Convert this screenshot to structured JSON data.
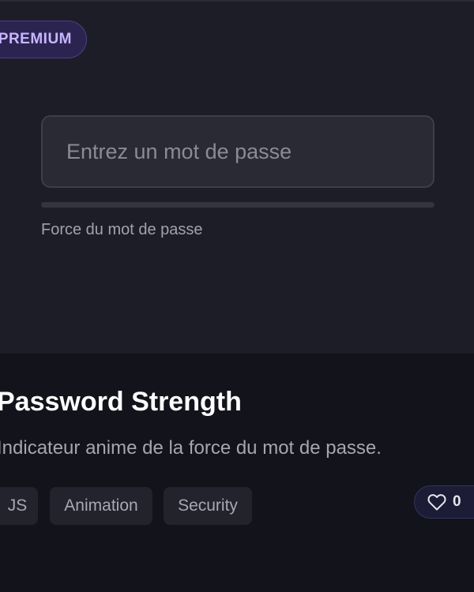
{
  "badge": {
    "label": "PREMIUM"
  },
  "demo": {
    "input_placeholder": "Entrez un mot de passe",
    "input_value": "",
    "strength_percent": 0,
    "strength_label": "Force du mot de passe"
  },
  "card": {
    "title": "Password Strength",
    "description": "Indicateur anime de la force du mot de passe.",
    "tags": [
      "JS",
      "Animation",
      "Security"
    ],
    "likes": "0"
  },
  "colors": {
    "accent": "#7c5cff",
    "badge_text": "#c7b5ff",
    "background": "#13131c"
  },
  "icons": {
    "like": "heart-icon"
  }
}
